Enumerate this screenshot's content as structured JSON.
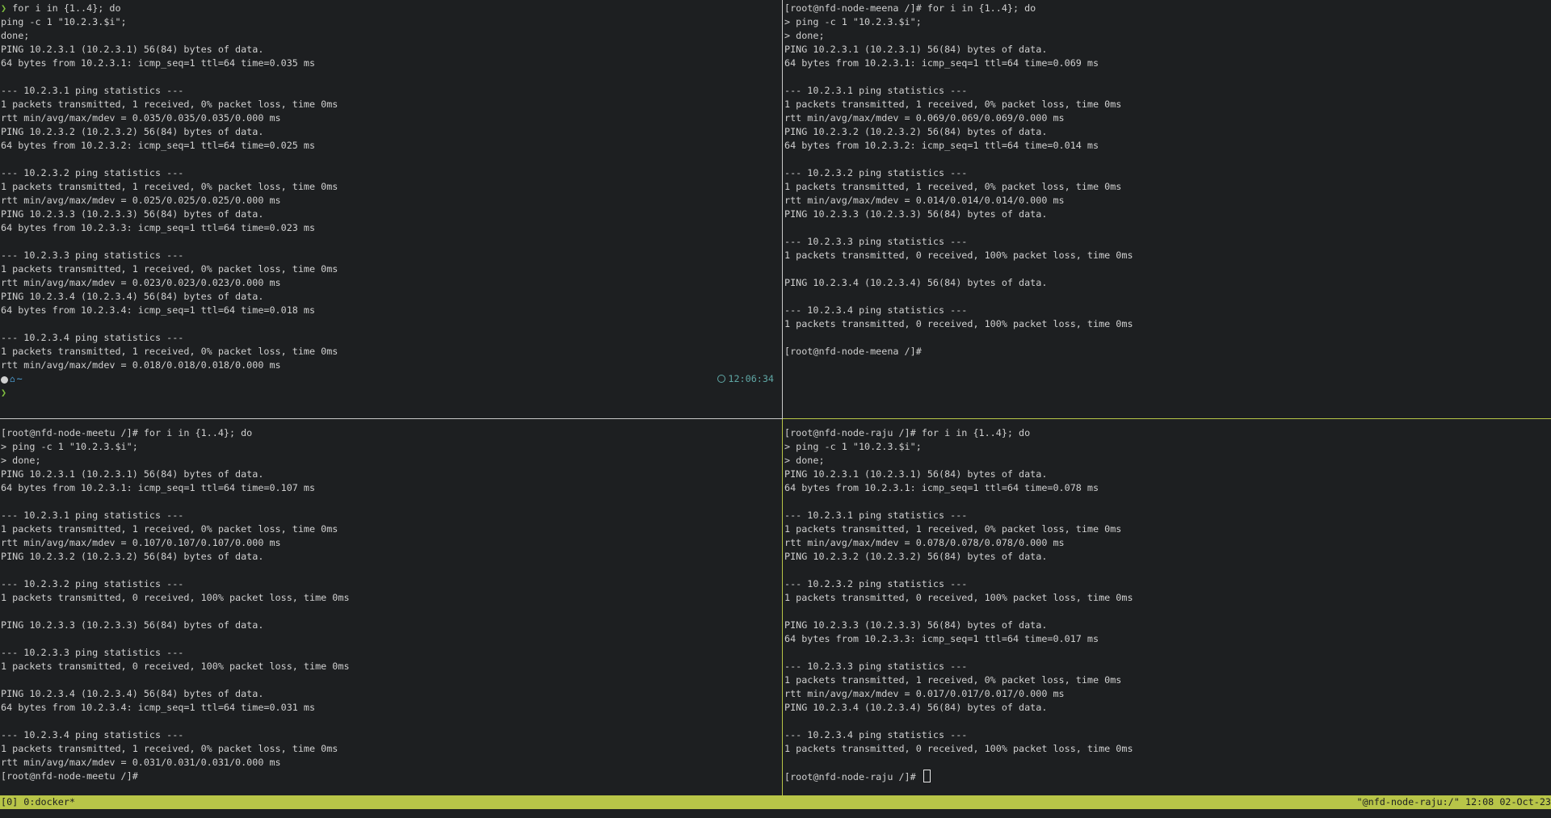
{
  "panes": {
    "top_left": {
      "lines": [
        "for i in {1..4}; do",
        "ping -c 1 \"10.2.3.$i\";",
        "done;",
        "PING 10.2.3.1 (10.2.3.1) 56(84) bytes of data.",
        "64 bytes from 10.2.3.1: icmp_seq=1 ttl=64 time=0.035 ms",
        "",
        "--- 10.2.3.1 ping statistics ---",
        "1 packets transmitted, 1 received, 0% packet loss, time 0ms",
        "rtt min/avg/max/mdev = 0.035/0.035/0.035/0.000 ms",
        "PING 10.2.3.2 (10.2.3.2) 56(84) bytes of data.",
        "64 bytes from 10.2.3.2: icmp_seq=1 ttl=64 time=0.025 ms",
        "",
        "--- 10.2.3.2 ping statistics ---",
        "1 packets transmitted, 1 received, 0% packet loss, time 0ms",
        "rtt min/avg/max/mdev = 0.025/0.025/0.025/0.000 ms",
        "PING 10.2.3.3 (10.2.3.3) 56(84) bytes of data.",
        "64 bytes from 10.2.3.3: icmp_seq=1 ttl=64 time=0.023 ms",
        "",
        "--- 10.2.3.3 ping statistics ---",
        "1 packets transmitted, 1 received, 0% packet loss, time 0ms",
        "rtt min/avg/max/mdev = 0.023/0.023/0.023/0.000 ms",
        "PING 10.2.3.4 (10.2.3.4) 56(84) bytes of data.",
        "64 bytes from 10.2.3.4: icmp_seq=1 ttl=64 time=0.018 ms",
        "",
        "--- 10.2.3.4 ping statistics ---",
        "1 packets transmitted, 1 received, 0% packet loss, time 0ms",
        "rtt min/avg/max/mdev = 0.018/0.018/0.018/0.000 ms"
      ],
      "prompt_symbol": "❯",
      "prompt_path": "~",
      "clock": "12:06:34"
    },
    "top_right": {
      "lines": [
        "[root@nfd-node-meena /]# for i in {1..4}; do",
        "> ping -c 1 \"10.2.3.$i\";",
        "> done;",
        "PING 10.2.3.1 (10.2.3.1) 56(84) bytes of data.",
        "64 bytes from 10.2.3.1: icmp_seq=1 ttl=64 time=0.069 ms",
        "",
        "--- 10.2.3.1 ping statistics ---",
        "1 packets transmitted, 1 received, 0% packet loss, time 0ms",
        "rtt min/avg/max/mdev = 0.069/0.069/0.069/0.000 ms",
        "PING 10.2.3.2 (10.2.3.2) 56(84) bytes of data.",
        "64 bytes from 10.2.3.2: icmp_seq=1 ttl=64 time=0.014 ms",
        "",
        "--- 10.2.3.2 ping statistics ---",
        "1 packets transmitted, 1 received, 0% packet loss, time 0ms",
        "rtt min/avg/max/mdev = 0.014/0.014/0.014/0.000 ms",
        "PING 10.2.3.3 (10.2.3.3) 56(84) bytes of data.",
        "",
        "--- 10.2.3.3 ping statistics ---",
        "1 packets transmitted, 0 received, 100% packet loss, time 0ms",
        "",
        "PING 10.2.3.4 (10.2.3.4) 56(84) bytes of data.",
        "",
        "--- 10.2.3.4 ping statistics ---",
        "1 packets transmitted, 0 received, 100% packet loss, time 0ms",
        "",
        "[root@nfd-node-meena /]#"
      ]
    },
    "bottom_left": {
      "lines": [
        "[root@nfd-node-meetu /]# for i in {1..4}; do",
        "> ping -c 1 \"10.2.3.$i\";",
        "> done;",
        "PING 10.2.3.1 (10.2.3.1) 56(84) bytes of data.",
        "64 bytes from 10.2.3.1: icmp_seq=1 ttl=64 time=0.107 ms",
        "",
        "--- 10.2.3.1 ping statistics ---",
        "1 packets transmitted, 1 received, 0% packet loss, time 0ms",
        "rtt min/avg/max/mdev = 0.107/0.107/0.107/0.000 ms",
        "PING 10.2.3.2 (10.2.3.2) 56(84) bytes of data.",
        "",
        "--- 10.2.3.2 ping statistics ---",
        "1 packets transmitted, 0 received, 100% packet loss, time 0ms",
        "",
        "PING 10.2.3.3 (10.2.3.3) 56(84) bytes of data.",
        "",
        "--- 10.2.3.3 ping statistics ---",
        "1 packets transmitted, 0 received, 100% packet loss, time 0ms",
        "",
        "PING 10.2.3.4 (10.2.3.4) 56(84) bytes of data.",
        "64 bytes from 10.2.3.4: icmp_seq=1 ttl=64 time=0.031 ms",
        "",
        "--- 10.2.3.4 ping statistics ---",
        "1 packets transmitted, 1 received, 0% packet loss, time 0ms",
        "rtt min/avg/max/mdev = 0.031/0.031/0.031/0.000 ms",
        "[root@nfd-node-meetu /]#"
      ]
    },
    "bottom_right": {
      "lines": [
        "[root@nfd-node-raju /]# for i in {1..4}; do",
        "> ping -c 1 \"10.2.3.$i\";",
        "> done;",
        "PING 10.2.3.1 (10.2.3.1) 56(84) bytes of data.",
        "64 bytes from 10.2.3.1: icmp_seq=1 ttl=64 time=0.078 ms",
        "",
        "--- 10.2.3.1 ping statistics ---",
        "1 packets transmitted, 1 received, 0% packet loss, time 0ms",
        "rtt min/avg/max/mdev = 0.078/0.078/0.078/0.000 ms",
        "PING 10.2.3.2 (10.2.3.2) 56(84) bytes of data.",
        "",
        "--- 10.2.3.2 ping statistics ---",
        "1 packets transmitted, 0 received, 100% packet loss, time 0ms",
        "",
        "PING 10.2.3.3 (10.2.3.3) 56(84) bytes of data.",
        "64 bytes from 10.2.3.3: icmp_seq=1 ttl=64 time=0.017 ms",
        "",
        "--- 10.2.3.3 ping statistics ---",
        "1 packets transmitted, 1 received, 0% packet loss, time 0ms",
        "rtt min/avg/max/mdev = 0.017/0.017/0.017/0.000 ms",
        "PING 10.2.3.4 (10.2.3.4) 56(84) bytes of data.",
        "",
        "--- 10.2.3.4 ping statistics ---",
        "1 packets transmitted, 0 received, 100% packet loss, time 0ms",
        "",
        "[root@nfd-node-raju /]# "
      ]
    }
  },
  "statusbar": {
    "left": "[0] 0:docker*",
    "right": "\"@nfd-node-raju:/\" 12:08 02-Oct-23"
  },
  "colors": {
    "background": "#1d1f21",
    "text": "#d0d0d0",
    "active_accent": "#b8c548",
    "inactive_border": "#c9c9c9",
    "prompt_green": "#7fbf3f",
    "path_blue": "#4fa3d9",
    "clock_teal": "#5fa7a5"
  },
  "icons": [
    "os-logo-icon",
    "home-icon",
    "clock-icon",
    "prompt-chevron-icon"
  ]
}
